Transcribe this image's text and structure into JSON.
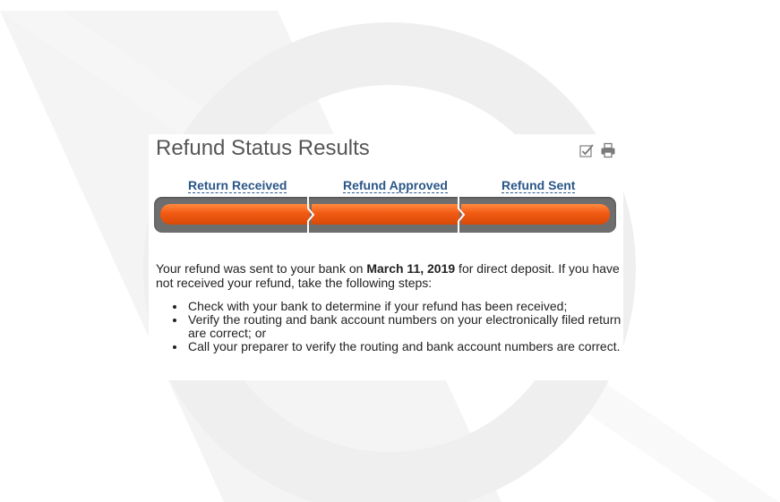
{
  "page": {
    "title": "Refund Status Results",
    "tools": [
      {
        "icon": "checklist-icon"
      },
      {
        "icon": "print-icon"
      }
    ],
    "steps": [
      {
        "label": "Return Received"
      },
      {
        "label": "Refund Approved"
      },
      {
        "label": "Refund Sent"
      }
    ],
    "progress": {
      "completed_steps": 3,
      "total_steps": 3
    },
    "message": {
      "before": "Your refund was sent to your bank on ",
      "date": "March 11, 2019",
      "after": " for direct deposit. If you have not received your refund, take the following steps:"
    },
    "list": [
      "Check with your bank to determine if your refund has been received;",
      "Verify the routing and bank account numbers on your electronically filed return are correct; or",
      "Call your preparer to verify the routing and bank account numbers are correct."
    ]
  },
  "colors": {
    "accent_orange": "#f15a13",
    "link_blue": "#2a5688",
    "track_gray": "#6e6e6e",
    "title_gray": "#555555"
  }
}
